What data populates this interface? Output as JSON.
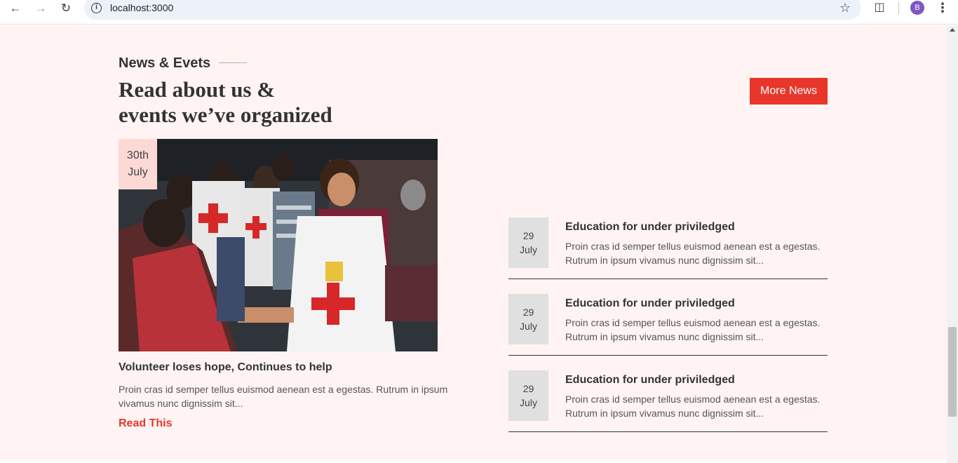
{
  "browser": {
    "url": "localhost:3000",
    "avatar_letter": "B"
  },
  "section": {
    "eyebrow": "News & Evets",
    "heading_line1": "Read about us &",
    "heading_line2": "events we’ve organized",
    "more_button": "More News"
  },
  "feature": {
    "date_day": "30th",
    "date_month": "July",
    "title": "Volunteer loses hope, Continues to help",
    "excerpt": "Proin cras id semper tellus euismod aenean est a egestas. Rutrum in ipsum vivamus nunc dignissim sit...",
    "link": "Read This"
  },
  "news": [
    {
      "day": "29",
      "month": "July",
      "title": "Education for under priviledged",
      "excerpt": "Proin cras id semper tellus euismod aenean est a egestas. Rutrum in ipsum vivamus nunc dignissim sit..."
    },
    {
      "day": "29",
      "month": "July",
      "title": "Education for under priviledged",
      "excerpt": "Proin cras id semper tellus euismod aenean est a egestas. Rutrum in ipsum vivamus nunc dignissim sit..."
    },
    {
      "day": "29",
      "month": "July",
      "title": "Education for under priviledged",
      "excerpt": "Proin cras id semper tellus euismod aenean est a egestas. Rutrum in ipsum vivamus nunc dignissim sit..."
    }
  ],
  "colors": {
    "accent": "#e8362a",
    "page_bg": "#fff4f3",
    "badge_pink": "#fdd9d6",
    "badge_grey": "#e0e0e0"
  }
}
